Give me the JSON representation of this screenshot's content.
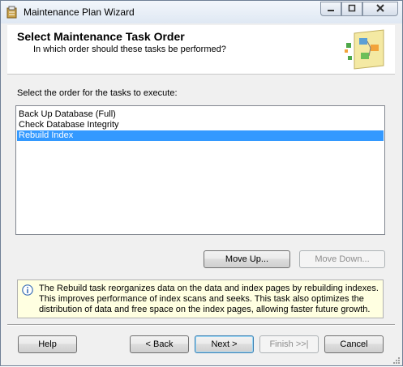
{
  "window": {
    "title": "Maintenance Plan Wizard"
  },
  "header": {
    "title": "Select Maintenance Task Order",
    "subtitle": "In which order should these tasks be performed?"
  },
  "instruction": "Select the order for the tasks to execute:",
  "tasks": [
    {
      "label": "Back Up Database (Full)",
      "selected": false
    },
    {
      "label": "Check Database Integrity",
      "selected": false
    },
    {
      "label": "Rebuild Index",
      "selected": true
    }
  ],
  "buttons": {
    "move_up": "Move Up...",
    "move_down": "Move Down...",
    "help": "Help",
    "back": "< Back",
    "next": "Next >",
    "finish": "Finish >>|",
    "cancel": "Cancel"
  },
  "info": {
    "text": "The Rebuild task reorganizes data on the data and index pages by rebuilding indexes. This improves performance of index scans and seeks. This task also optimizes the distribution of data and free space on the index pages, allowing faster future growth."
  },
  "colors": {
    "selection": "#3399ff",
    "info_background": "#ffffe1",
    "dialog_background": "#f0f0f0"
  }
}
